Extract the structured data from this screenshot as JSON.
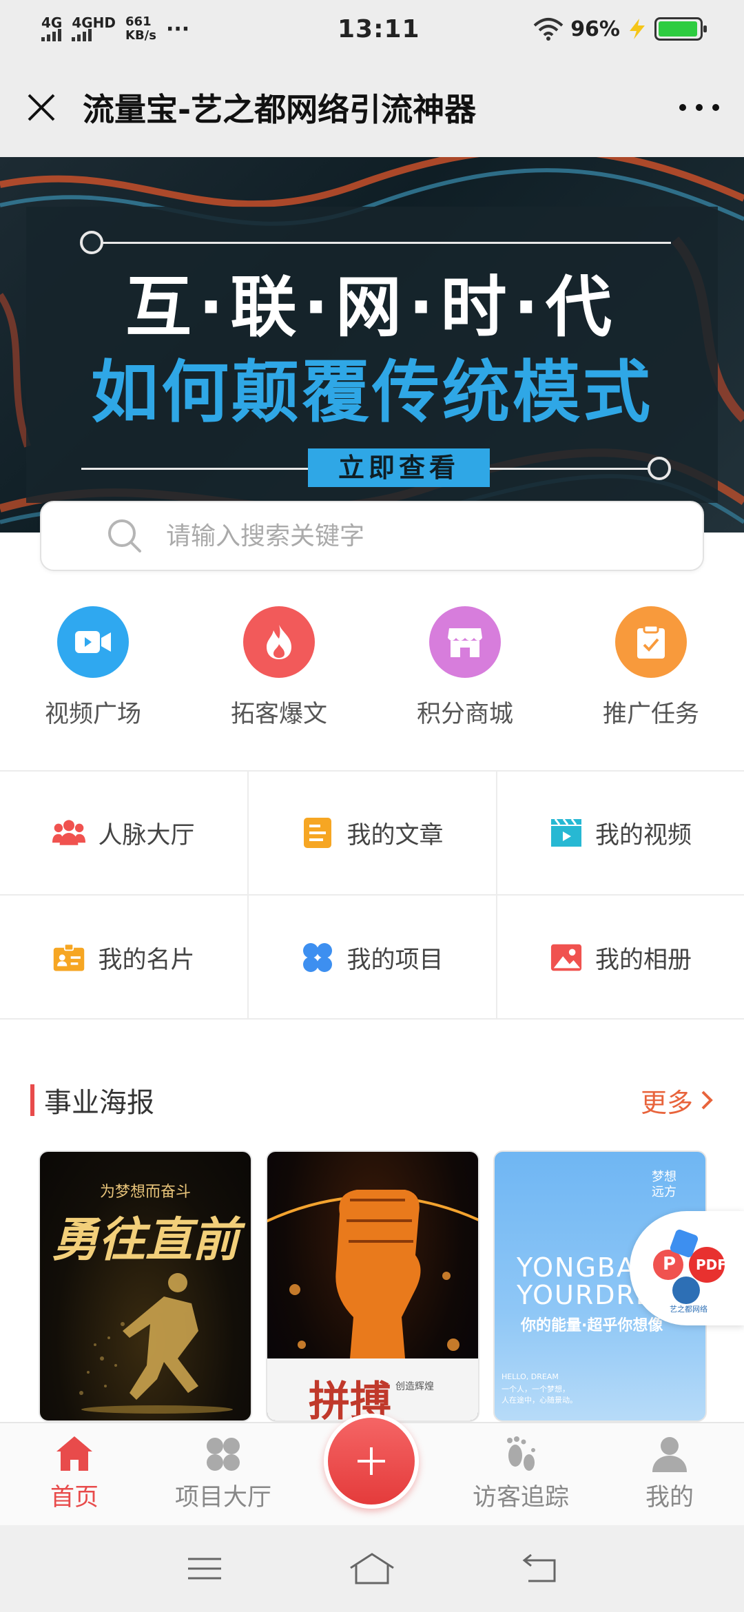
{
  "status_bar": {
    "net1": "4G",
    "net2": "4GHD",
    "speed_value": "661",
    "speed_unit": "KB/s",
    "dots": "···",
    "time": "13:11",
    "battery": "96%",
    "battery_level": 0.96
  },
  "title_bar": {
    "title": "流量宝-艺之都网络引流神器",
    "close_icon": "close-icon",
    "more_icon": "more-icon"
  },
  "banner": {
    "line1": "互·联·网·时·代",
    "line2": "如何颠覆传统模式",
    "button": "立即查看"
  },
  "search": {
    "placeholder": "请输入搜索关键字"
  },
  "quick_links": [
    {
      "label": "视频广场",
      "icon": "video-icon",
      "color": "#2fa8f0"
    },
    {
      "label": "拓客爆文",
      "icon": "fire-icon",
      "color": "#f25a5a"
    },
    {
      "label": "积分商城",
      "icon": "store-icon",
      "color": "#d77ddc"
    },
    {
      "label": "推广任务",
      "icon": "task-icon",
      "color": "#f89a3c"
    }
  ],
  "grid": [
    {
      "label": "人脉大厅",
      "icon": "people-icon",
      "color": "#f0524f"
    },
    {
      "label": "我的文章",
      "icon": "article-icon",
      "color": "#f6a623"
    },
    {
      "label": "我的视频",
      "icon": "clapper-icon",
      "color": "#27b8d3"
    },
    {
      "label": "我的名片",
      "icon": "card-icon",
      "color": "#f6a623"
    },
    {
      "label": "我的项目",
      "icon": "clover-icon",
      "color": "#3d8ff0"
    },
    {
      "label": "我的相册",
      "icon": "photo-icon",
      "color": "#f0524f"
    }
  ],
  "section": {
    "title": "事业海报",
    "more": "更多"
  },
  "posters": [
    {
      "title": "勇往直前",
      "tag": "为梦想而奋斗"
    },
    {
      "title": "拼搏",
      "tag": "创造辉煌"
    },
    {
      "title_en1": "YONGBA",
      "title_en2": "YOURDRE",
      "subtitle": "你的能量·超乎你想像",
      "corner": "梦想远方",
      "note1": "HELLO, DREAM",
      "note2": "一个人，一个梦想，",
      "note3": "人在途中，心随景动。"
    }
  ],
  "float_badge": {
    "pdf": "PDF",
    "p": "P",
    "brand": "艺之都网络"
  },
  "bottom_nav": [
    {
      "label": "首页",
      "icon": "home-icon",
      "active": true
    },
    {
      "label": "项目大厅",
      "icon": "clover-icon",
      "active": false
    },
    {
      "label": "访客追踪",
      "icon": "footprint-icon",
      "active": false
    },
    {
      "label": "我的",
      "icon": "user-icon",
      "active": false
    }
  ],
  "colors": {
    "accent": "#e84b4b",
    "banner_blue": "#2fa7e6",
    "more_orange": "#e8643c"
  }
}
